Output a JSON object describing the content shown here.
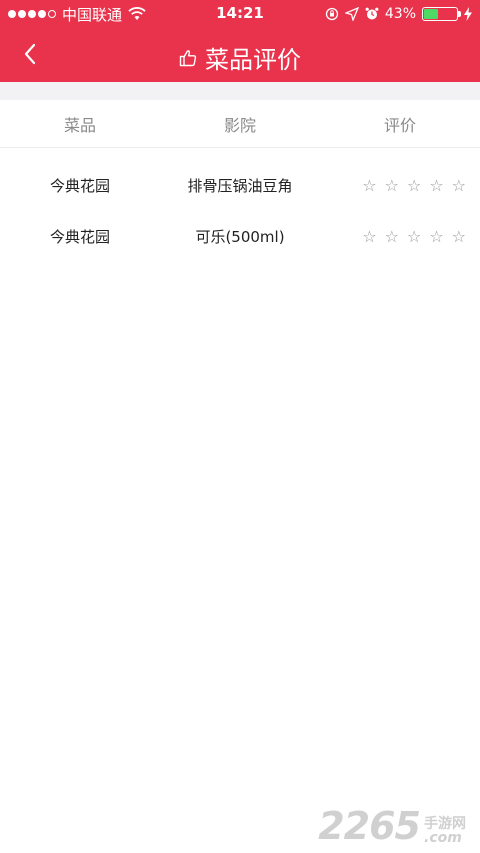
{
  "status_bar": {
    "carrier": "中国联通",
    "time": "14:21",
    "battery_percent_text": "43%",
    "battery_level": 0.43
  },
  "nav": {
    "title": "菜品评价"
  },
  "table": {
    "headers": [
      "菜品",
      "影院",
      "评价"
    ],
    "rows": [
      {
        "cinema": "今典花园",
        "dish": "排骨压锅油豆角",
        "rating": 0
      },
      {
        "cinema": "今典花园",
        "dish": "可乐(500ml)",
        "rating": 0
      }
    ],
    "star_glyph": "☆"
  },
  "watermark": {
    "number": "2265",
    "site_cn": "手游网",
    "site_suffix": ".com"
  },
  "colors": {
    "header_bg": "#e9324b",
    "separator_bg": "#f2f2f4",
    "battery_fill": "#4cd964"
  },
  "icons": {
    "back": "chevron-left-icon",
    "thumbs_up": "thumbs-up-icon",
    "wifi": "wifi-icon",
    "lock_rotation": "lock-rotation-icon",
    "location": "location-arrow-icon",
    "alarm": "alarm-icon",
    "charging": "charging-bolt-icon"
  }
}
